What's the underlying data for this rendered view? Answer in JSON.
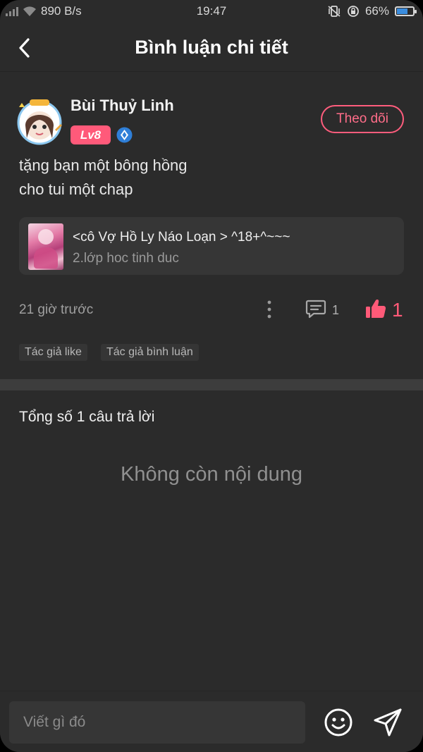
{
  "status_bar": {
    "network_speed": "890 B/s",
    "time": "19:47",
    "battery": "66%"
  },
  "header": {
    "title": "Bình luận chi tiết"
  },
  "comment": {
    "username": "Bùi Thuỷ Linh",
    "level": "Lv8",
    "follow_label": "Theo dõi",
    "text_lines": [
      "tặng bạn một bông hồng",
      "cho tui một chap"
    ],
    "story": {
      "title": "<cô Vợ Hồ Ly Náo Loạn > ^18+^~~~",
      "chapter": "2.lớp hoc tinh duc"
    },
    "time_ago": "21 giờ trước",
    "reply_count": "1",
    "like_count": "1",
    "tags": [
      "Tác giả like",
      "Tác giả bình luận"
    ]
  },
  "replies": {
    "total_label": "Tổng số 1 câu trả lời",
    "empty_label": "Không còn nội dung"
  },
  "input": {
    "placeholder": "Viết gì đó"
  },
  "colors": {
    "background": "#2b2b2b",
    "accent": "#ff5a78",
    "level_badge": "#ff5a7a",
    "diamond": "#2f7fd8"
  }
}
